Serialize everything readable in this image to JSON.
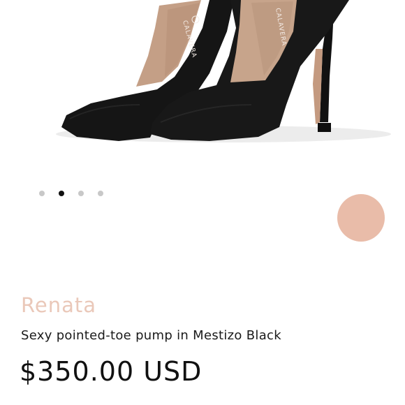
{
  "product": {
    "name": "Renata",
    "description": "Sexy pointed-toe pump in Mestizo Black",
    "price": "$350.00 USD",
    "name_color": "#eac8b9",
    "image_brand_text": "CALAVERA"
  },
  "carousel": {
    "total_slides": 4,
    "active_index": 1
  },
  "swatch": {
    "color": "#e9bca9",
    "name": "swatch-nude"
  }
}
